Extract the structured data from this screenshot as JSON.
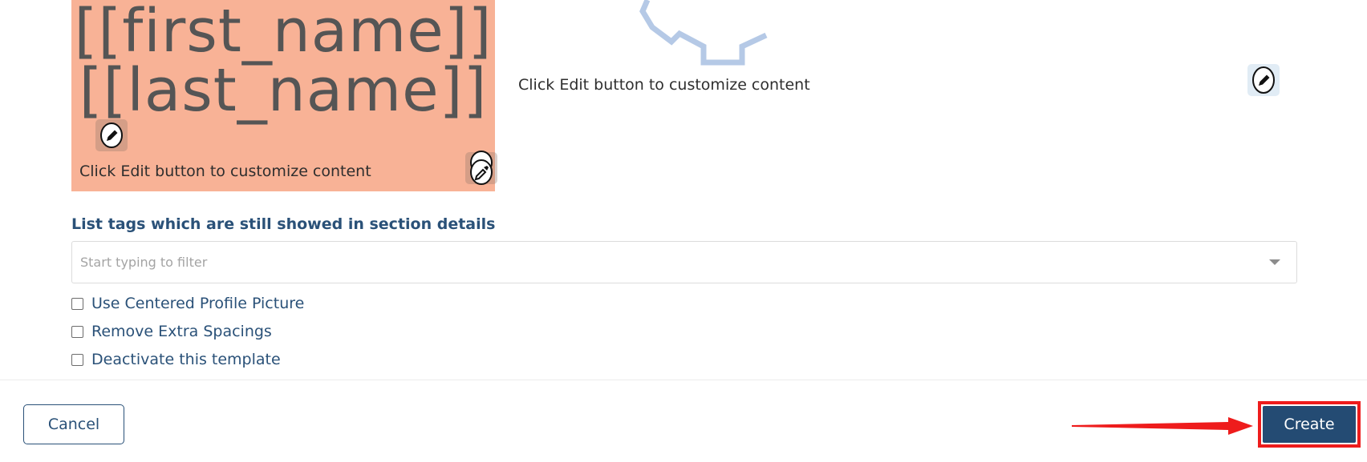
{
  "preview_card": {
    "first_name_tag": "[[first_name]]",
    "last_name_tag": "[[last_name]]",
    "caption": "Click Edit button to customize content",
    "background_color": "#f8b296"
  },
  "right_panel": {
    "caption": "Click Edit button to customize content"
  },
  "tags_section": {
    "label": "List tags which are still showed in section details",
    "filter_placeholder": "Start typing to filter",
    "filter_value": ""
  },
  "options": [
    {
      "label": "Use Centered Profile Picture",
      "checked": false
    },
    {
      "label": "Remove Extra Spacings",
      "checked": false
    },
    {
      "label": "Deactivate this template",
      "checked": false
    }
  ],
  "footer": {
    "cancel_label": "Cancel",
    "create_label": "Create"
  },
  "colors": {
    "primary": "#244b73",
    "label_text": "#2a5178",
    "highlight_annotation": "#ee1c1c"
  },
  "icons": {
    "edit": "pencil-edit-icon",
    "eyedropper": "eyedropper-icon",
    "gear": "gear-icon",
    "arrow": "arrow-right-icon"
  }
}
